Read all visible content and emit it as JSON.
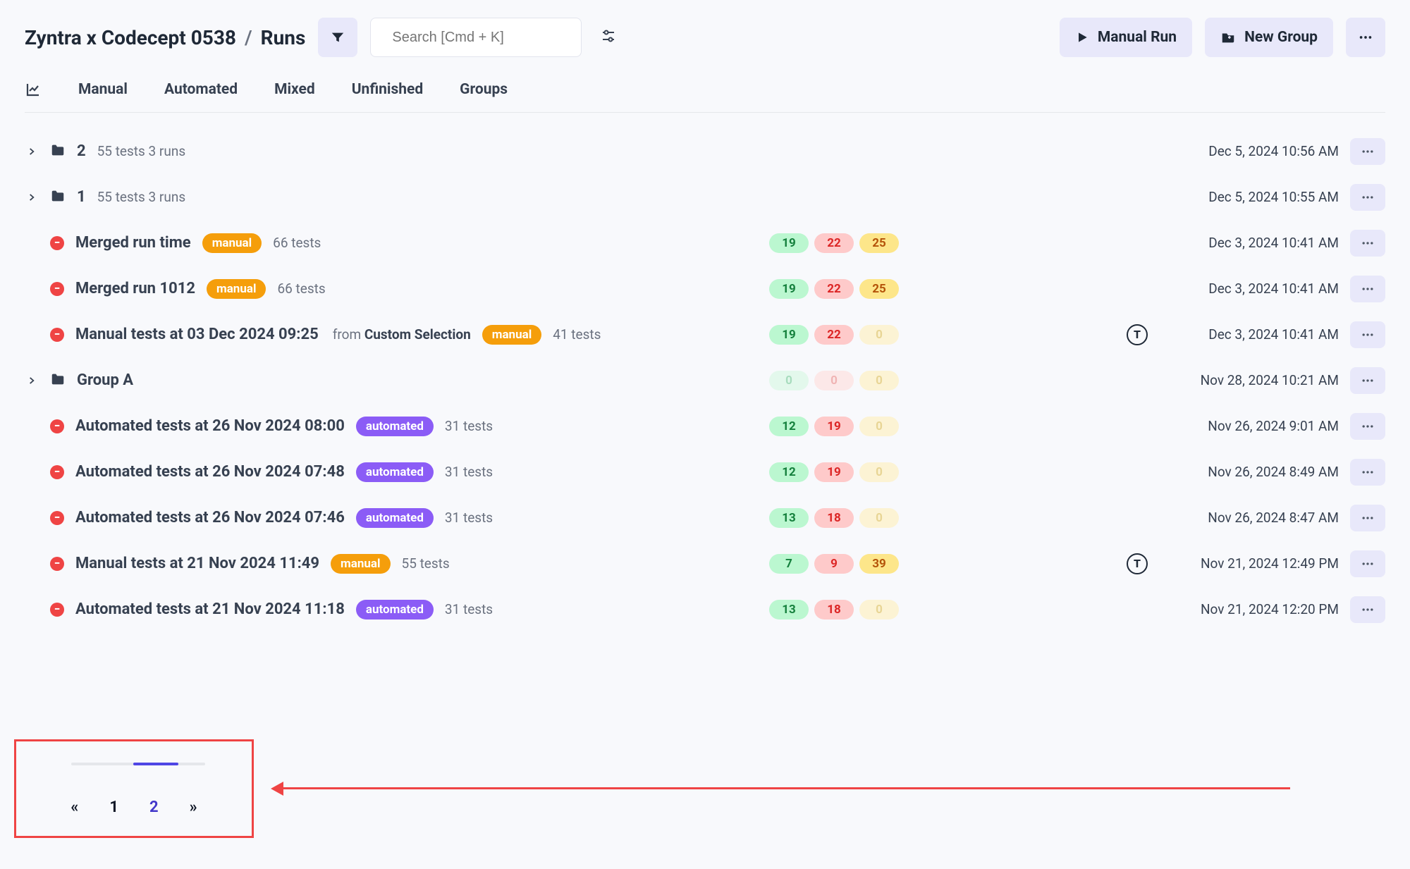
{
  "breadcrumb": {
    "project": "Zyntra x Codecept 0538",
    "page": "Runs"
  },
  "search": {
    "placeholder": "Search [Cmd + K]"
  },
  "header_buttons": {
    "manual_run": "Manual Run",
    "new_group": "New Group"
  },
  "tabs": [
    "Manual",
    "Automated",
    "Mixed",
    "Unfinished",
    "Groups"
  ],
  "runs": [
    {
      "kind": "folder",
      "name": "2",
      "meta": "55 tests  3 runs",
      "ts": "Dec 5, 2024 10:56 AM"
    },
    {
      "kind": "folder",
      "name": "1",
      "meta": "55 tests  3 runs",
      "ts": "Dec 5, 2024 10:55 AM"
    },
    {
      "kind": "run",
      "name": "Merged run time",
      "tag": "manual",
      "meta": "66 tests",
      "pills": {
        "green": "19",
        "red": "22",
        "yellow": "25"
      },
      "ts": "Dec 3, 2024 10:41 AM"
    },
    {
      "kind": "run",
      "name": "Merged run 1012",
      "tag": "manual",
      "meta": "66 tests",
      "pills": {
        "green": "19",
        "red": "22",
        "yellow": "25"
      },
      "ts": "Dec 3, 2024 10:41 AM"
    },
    {
      "kind": "run",
      "name": "Manual tests at 03 Dec 2024 09:25",
      "from": "Custom Selection",
      "tag": "manual",
      "meta": "41 tests",
      "pills": {
        "green": "19",
        "red": "22",
        "yellow": "0",
        "yellow_faded": true
      },
      "agent": "T",
      "ts": "Dec 3, 2024 10:41 AM"
    },
    {
      "kind": "folder",
      "name": "Group A",
      "pills": {
        "green": "0",
        "red": "0",
        "yellow": "0",
        "all_faded": true
      },
      "ts": "Nov 28, 2024 10:21 AM"
    },
    {
      "kind": "run",
      "name": "Automated tests at 26 Nov 2024 08:00",
      "tag": "automated",
      "meta": "31 tests",
      "pills": {
        "green": "12",
        "red": "19",
        "yellow": "0",
        "yellow_faded": true
      },
      "ts": "Nov 26, 2024 9:01 AM"
    },
    {
      "kind": "run",
      "name": "Automated tests at 26 Nov 2024 07:48",
      "tag": "automated",
      "meta": "31 tests",
      "pills": {
        "green": "12",
        "red": "19",
        "yellow": "0",
        "yellow_faded": true
      },
      "ts": "Nov 26, 2024 8:49 AM"
    },
    {
      "kind": "run",
      "name": "Automated tests at 26 Nov 2024 07:46",
      "tag": "automated",
      "meta": "31 tests",
      "pills": {
        "green": "13",
        "red": "18",
        "yellow": "0",
        "yellow_faded": true
      },
      "ts": "Nov 26, 2024 8:47 AM"
    },
    {
      "kind": "run",
      "name": "Manual tests at 21 Nov 2024 11:49",
      "tag": "manual",
      "meta": "55 tests",
      "pills": {
        "green": "7",
        "red": "9",
        "yellow": "39"
      },
      "agent": "T",
      "ts": "Nov 21, 2024 12:49 PM"
    },
    {
      "kind": "run",
      "name": "Automated tests at 21 Nov 2024 11:18",
      "tag": "automated",
      "meta": "31 tests",
      "pills": {
        "green": "13",
        "red": "18",
        "yellow": "0",
        "yellow_faded": true
      },
      "ts": "Nov 21, 2024 12:20 PM"
    }
  ],
  "pagination": {
    "prev": "«",
    "pages": [
      "1",
      "2"
    ],
    "active": "2",
    "next": "»"
  }
}
